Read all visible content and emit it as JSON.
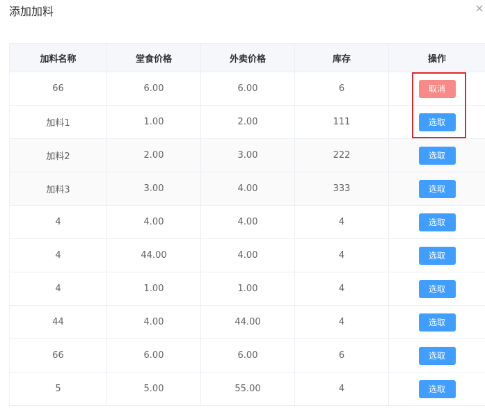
{
  "dialog": {
    "title": "添加加料",
    "close_icon": "close-icon"
  },
  "table": {
    "headers": [
      "加料名称",
      "堂食价格",
      "外卖价格",
      "库存",
      "操作"
    ],
    "rows": [
      {
        "name": "66",
        "dine_in_price": "6.00",
        "takeout_price": "6.00",
        "stock": "6",
        "action": "取消",
        "action_type": "cancel"
      },
      {
        "name": "加料1",
        "dine_in_price": "1.00",
        "takeout_price": "2.00",
        "stock": "111",
        "action": "选取",
        "action_type": "select"
      },
      {
        "name": "加料2",
        "dine_in_price": "2.00",
        "takeout_price": "3.00",
        "stock": "222",
        "action": "选取",
        "action_type": "select"
      },
      {
        "name": "加料3",
        "dine_in_price": "3.00",
        "takeout_price": "4.00",
        "stock": "333",
        "action": "选取",
        "action_type": "select"
      },
      {
        "name": "4",
        "dine_in_price": "4.00",
        "takeout_price": "4.00",
        "stock": "4",
        "action": "选取",
        "action_type": "select"
      },
      {
        "name": "4",
        "dine_in_price": "44.00",
        "takeout_price": "4.00",
        "stock": "4",
        "action": "选取",
        "action_type": "select"
      },
      {
        "name": "4",
        "dine_in_price": "1.00",
        "takeout_price": "1.00",
        "stock": "4",
        "action": "选取",
        "action_type": "select"
      },
      {
        "name": "44",
        "dine_in_price": "4.00",
        "takeout_price": "44.00",
        "stock": "4",
        "action": "选取",
        "action_type": "select"
      },
      {
        "name": "66",
        "dine_in_price": "6.00",
        "takeout_price": "6.00",
        "stock": "6",
        "action": "选取",
        "action_type": "select"
      },
      {
        "name": "5",
        "dine_in_price": "5.00",
        "takeout_price": "55.00",
        "stock": "4",
        "action": "选取",
        "action_type": "select"
      }
    ]
  },
  "colors": {
    "select_button": "#409eff",
    "cancel_button": "#f78989",
    "highlight_border": "#e0262b",
    "header_bg": "#f5f7fa"
  }
}
